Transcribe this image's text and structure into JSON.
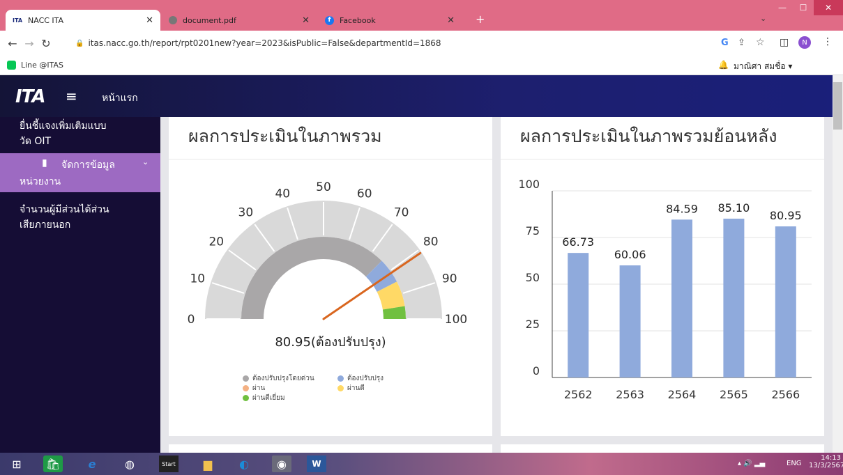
{
  "browser": {
    "tabs": [
      {
        "title": "NACC ITA",
        "icon": "ita-logo-icon"
      },
      {
        "title": "document.pdf",
        "icon": "globe-icon"
      },
      {
        "title": "Facebook",
        "icon": "facebook-icon"
      }
    ],
    "new_tab": "+",
    "url": "itas.nacc.go.th/report/rpt0201new?year=2023&isPublic=False&departmentId=1868",
    "bookmark": "Line @ITAS",
    "user_name": "มาณิศา สมชื่อ ▾",
    "profile_initial": "N"
  },
  "app": {
    "logo": "ITA",
    "menu_label": "หน้าแรก"
  },
  "sidebar": {
    "items": [
      {
        "label_line1": "ยื่นชี้แจงเพิ่มเติมแบบ",
        "label_line2": "วัด OIT"
      },
      {
        "label_line1": "จัดการข้อมูล",
        "label_line2": "หน่วยงาน"
      },
      {
        "label_line1": "จำนวนผู้มีส่วนได้ส่วน",
        "label_line2": "เสียภายนอก"
      }
    ]
  },
  "gauge_card": {
    "title": "ผลการประเมินในภาพรวม",
    "value": 80.95,
    "value_label": "80.95(ต้องปรับปรุง)",
    "ticks": [
      "0",
      "10",
      "20",
      "30",
      "40",
      "50",
      "60",
      "70",
      "80",
      "90",
      "100"
    ],
    "legend": [
      {
        "label": "ต้องปรับปรุงโดยด่วน",
        "color": "#a9a7a8"
      },
      {
        "label": "ต้องปรับปรุง",
        "color": "#8faadc"
      },
      {
        "label": "ผ่าน",
        "color": "#f4b183"
      },
      {
        "label": "ผ่านดี",
        "color": "#ffd966"
      },
      {
        "label": "ผ่านดีเยี่ยม",
        "color": "#70c040"
      }
    ]
  },
  "bar_card": {
    "title": "ผลการประเมินในภาพรวมย้อนหลัง"
  },
  "chart_data": {
    "type": "bar",
    "categories": [
      "2562",
      "2563",
      "2564",
      "2565",
      "2566"
    ],
    "values": [
      66.73,
      60.06,
      84.59,
      85.1,
      80.95
    ],
    "value_labels": [
      "66.73",
      "60.06",
      "84.59",
      "85.10",
      "80.95"
    ],
    "yticks": [
      "0",
      "25",
      "50",
      "75",
      "100"
    ],
    "ylim": [
      0,
      100
    ],
    "bar_color": "#8faadc"
  },
  "taskbar": {
    "time": "14:13",
    "date": "13/3/2567",
    "lang": "ENG",
    "start_label": "Start"
  }
}
